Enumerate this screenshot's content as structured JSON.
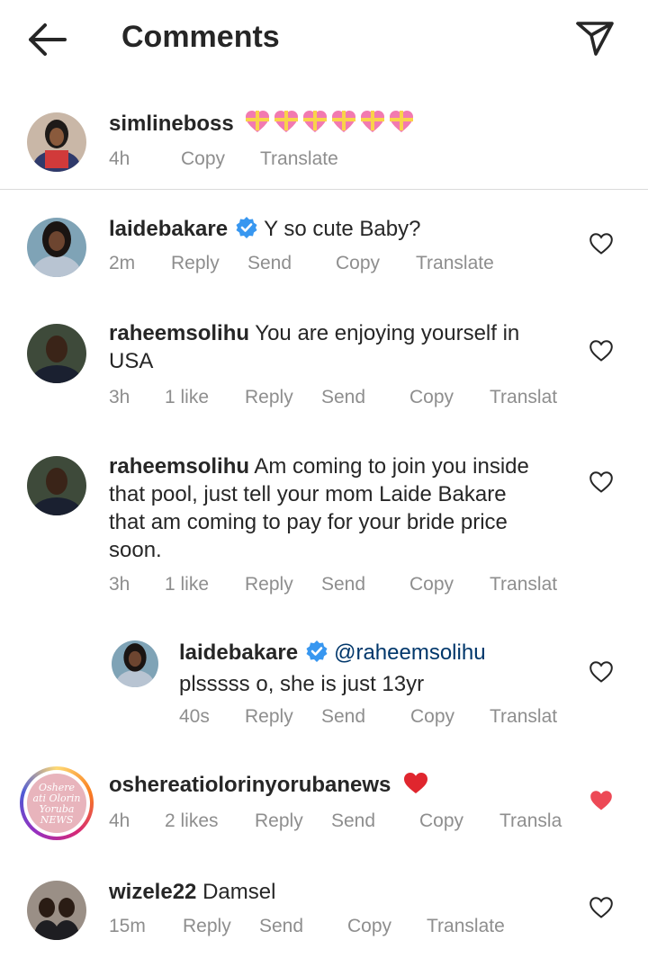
{
  "header": {
    "title": "Comments",
    "back_icon": "arrow-left-icon",
    "share_icon": "paper-plane-icon"
  },
  "caption": {
    "username": "simlineboss",
    "emoji": "heart-with-ribbon x6",
    "time": "4h",
    "copy": "Copy",
    "translate": "Translate"
  },
  "comments": [
    {
      "username": "laidebakare",
      "verified": true,
      "text": "Y so cute Baby?",
      "time": "2m",
      "reply": "Reply",
      "send": "Send",
      "copy": "Copy",
      "translate": "Translate",
      "liked": false
    },
    {
      "username": "raheemsolihu",
      "text_line1": "You are enjoying yourself in",
      "text_line2": "USA",
      "time": "3h",
      "likes": "1 like",
      "reply": "Reply",
      "send": "Send",
      "copy": "Copy",
      "translate": "Translat",
      "liked": false
    },
    {
      "username": "raheemsolihu",
      "text_line1": "Am coming to join you inside",
      "text_line2": "that pool, just tell your mom Laide Bakare",
      "text_line3": "that am coming to pay for your bride price",
      "text_line4": "soon.",
      "time": "3h",
      "likes": "1 like",
      "reply": "Reply",
      "send": "Send",
      "copy": "Copy",
      "translate": "Translat",
      "liked": false
    },
    {
      "username": "laidebakare",
      "verified": true,
      "mention": "@raheemsolihu",
      "text_line2": "plsssss o, she is just 13yr",
      "time": "40s",
      "reply": "Reply",
      "send": "Send",
      "copy": "Copy",
      "translate": "Translat",
      "liked": false
    },
    {
      "username": "oshereatiolorinyorubanews",
      "avatar_text": "Oshere ati Olorin Yoruba NEWS",
      "time": "4h",
      "likes": "2 likes",
      "reply": "Reply",
      "send": "Send",
      "copy": "Copy",
      "translate": "Transla",
      "liked": true
    },
    {
      "username": "wizele22",
      "text": "Damsel",
      "time": "15m",
      "reply": "Reply",
      "send": "Send",
      "copy": "Copy",
      "translate": "Translate",
      "liked": false
    }
  ],
  "colors": {
    "text": "#262626",
    "secondary": "#8e8e8e",
    "verified": "#3897f0",
    "like_red": "#ed4956",
    "mention": "#00376b"
  }
}
